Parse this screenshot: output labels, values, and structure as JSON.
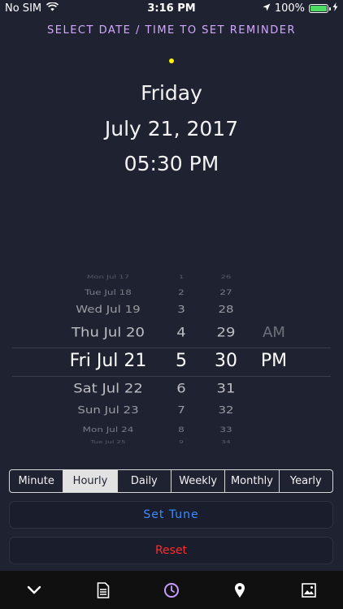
{
  "status_bar": {
    "carrier": "No SIM",
    "time": "3:16 PM",
    "battery_percent": "100%",
    "battery_level": 1.0
  },
  "header": {
    "title": "SELECT DATE / TIME TO SET REMINDER"
  },
  "selected": {
    "day": "Friday",
    "date": "July 21, 2017",
    "time": "05:30 PM"
  },
  "picker": {
    "dates": [
      "Mon Jul 17",
      "Tue Jul 18",
      "Wed Jul 19",
      "Thu Jul 20",
      "Fri Jul 21",
      "Sat Jul 22",
      "Sun Jul 23",
      "Mon Jul 24",
      "Tue Jul 25"
    ],
    "hours": [
      "1",
      "2",
      "3",
      "4",
      "5",
      "6",
      "7",
      "8",
      "9"
    ],
    "minutes": [
      "26",
      "27",
      "28",
      "29",
      "30",
      "31",
      "32",
      "33",
      "34"
    ],
    "ampm": [
      "AM",
      "PM"
    ]
  },
  "repeat_options": [
    "Minute",
    "Hourly",
    "Daily",
    "Weekly",
    "Monthly",
    "Yearly"
  ],
  "repeat_selected": "Hourly",
  "buttons": {
    "set_tune": "Set  Tune",
    "reset": "Reset"
  },
  "tabs": [
    {
      "icon": "chevron-down-icon"
    },
    {
      "icon": "document-icon"
    },
    {
      "icon": "clock-icon",
      "active": true
    },
    {
      "icon": "location-pin-icon"
    },
    {
      "icon": "image-icon"
    }
  ],
  "colors": {
    "background": "#1f2231",
    "header": "#d3a9ff",
    "accent_active_tab": "#c79cff",
    "set_tune": "#3a8dff",
    "reset": "#ff2b2b",
    "dot": "#fff100"
  }
}
